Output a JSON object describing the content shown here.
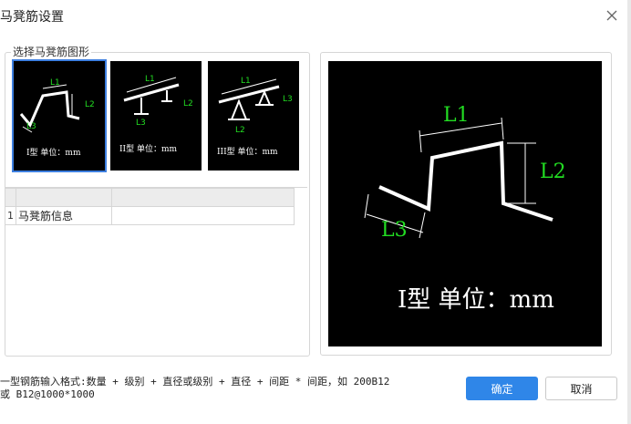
{
  "dialog": {
    "title": "马凳筋设置",
    "close_icon": "close-icon",
    "shape_group_label": "选择马凳筋图形",
    "shapes": [
      {
        "label": "I型 单位：mm",
        "selected": true
      },
      {
        "label": "II型 单位：mm",
        "selected": false
      },
      {
        "label": "III型 单位：mm",
        "selected": false
      }
    ],
    "dim_labels": {
      "l1": "L1",
      "l2": "L2",
      "l3": "L3"
    },
    "grid": {
      "headers": [
        "",
        ""
      ],
      "rows": [
        {
          "num": "1",
          "name": "马凳筋信息",
          "value": ""
        }
      ]
    },
    "preview_caption": "I型 单位：mm",
    "hint_line1": "一型钢筋输入格式:数量 + 级别 + 直径或级别 + 直径 + 间距 * 间距，如 200B12",
    "hint_line2": "或 B12@1000*1000",
    "ok_label": "确定",
    "cancel_label": "取消",
    "colors": {
      "accent": "#2f86e8",
      "dim_green": "#22dd22",
      "bar_white": "#ffffff"
    }
  }
}
